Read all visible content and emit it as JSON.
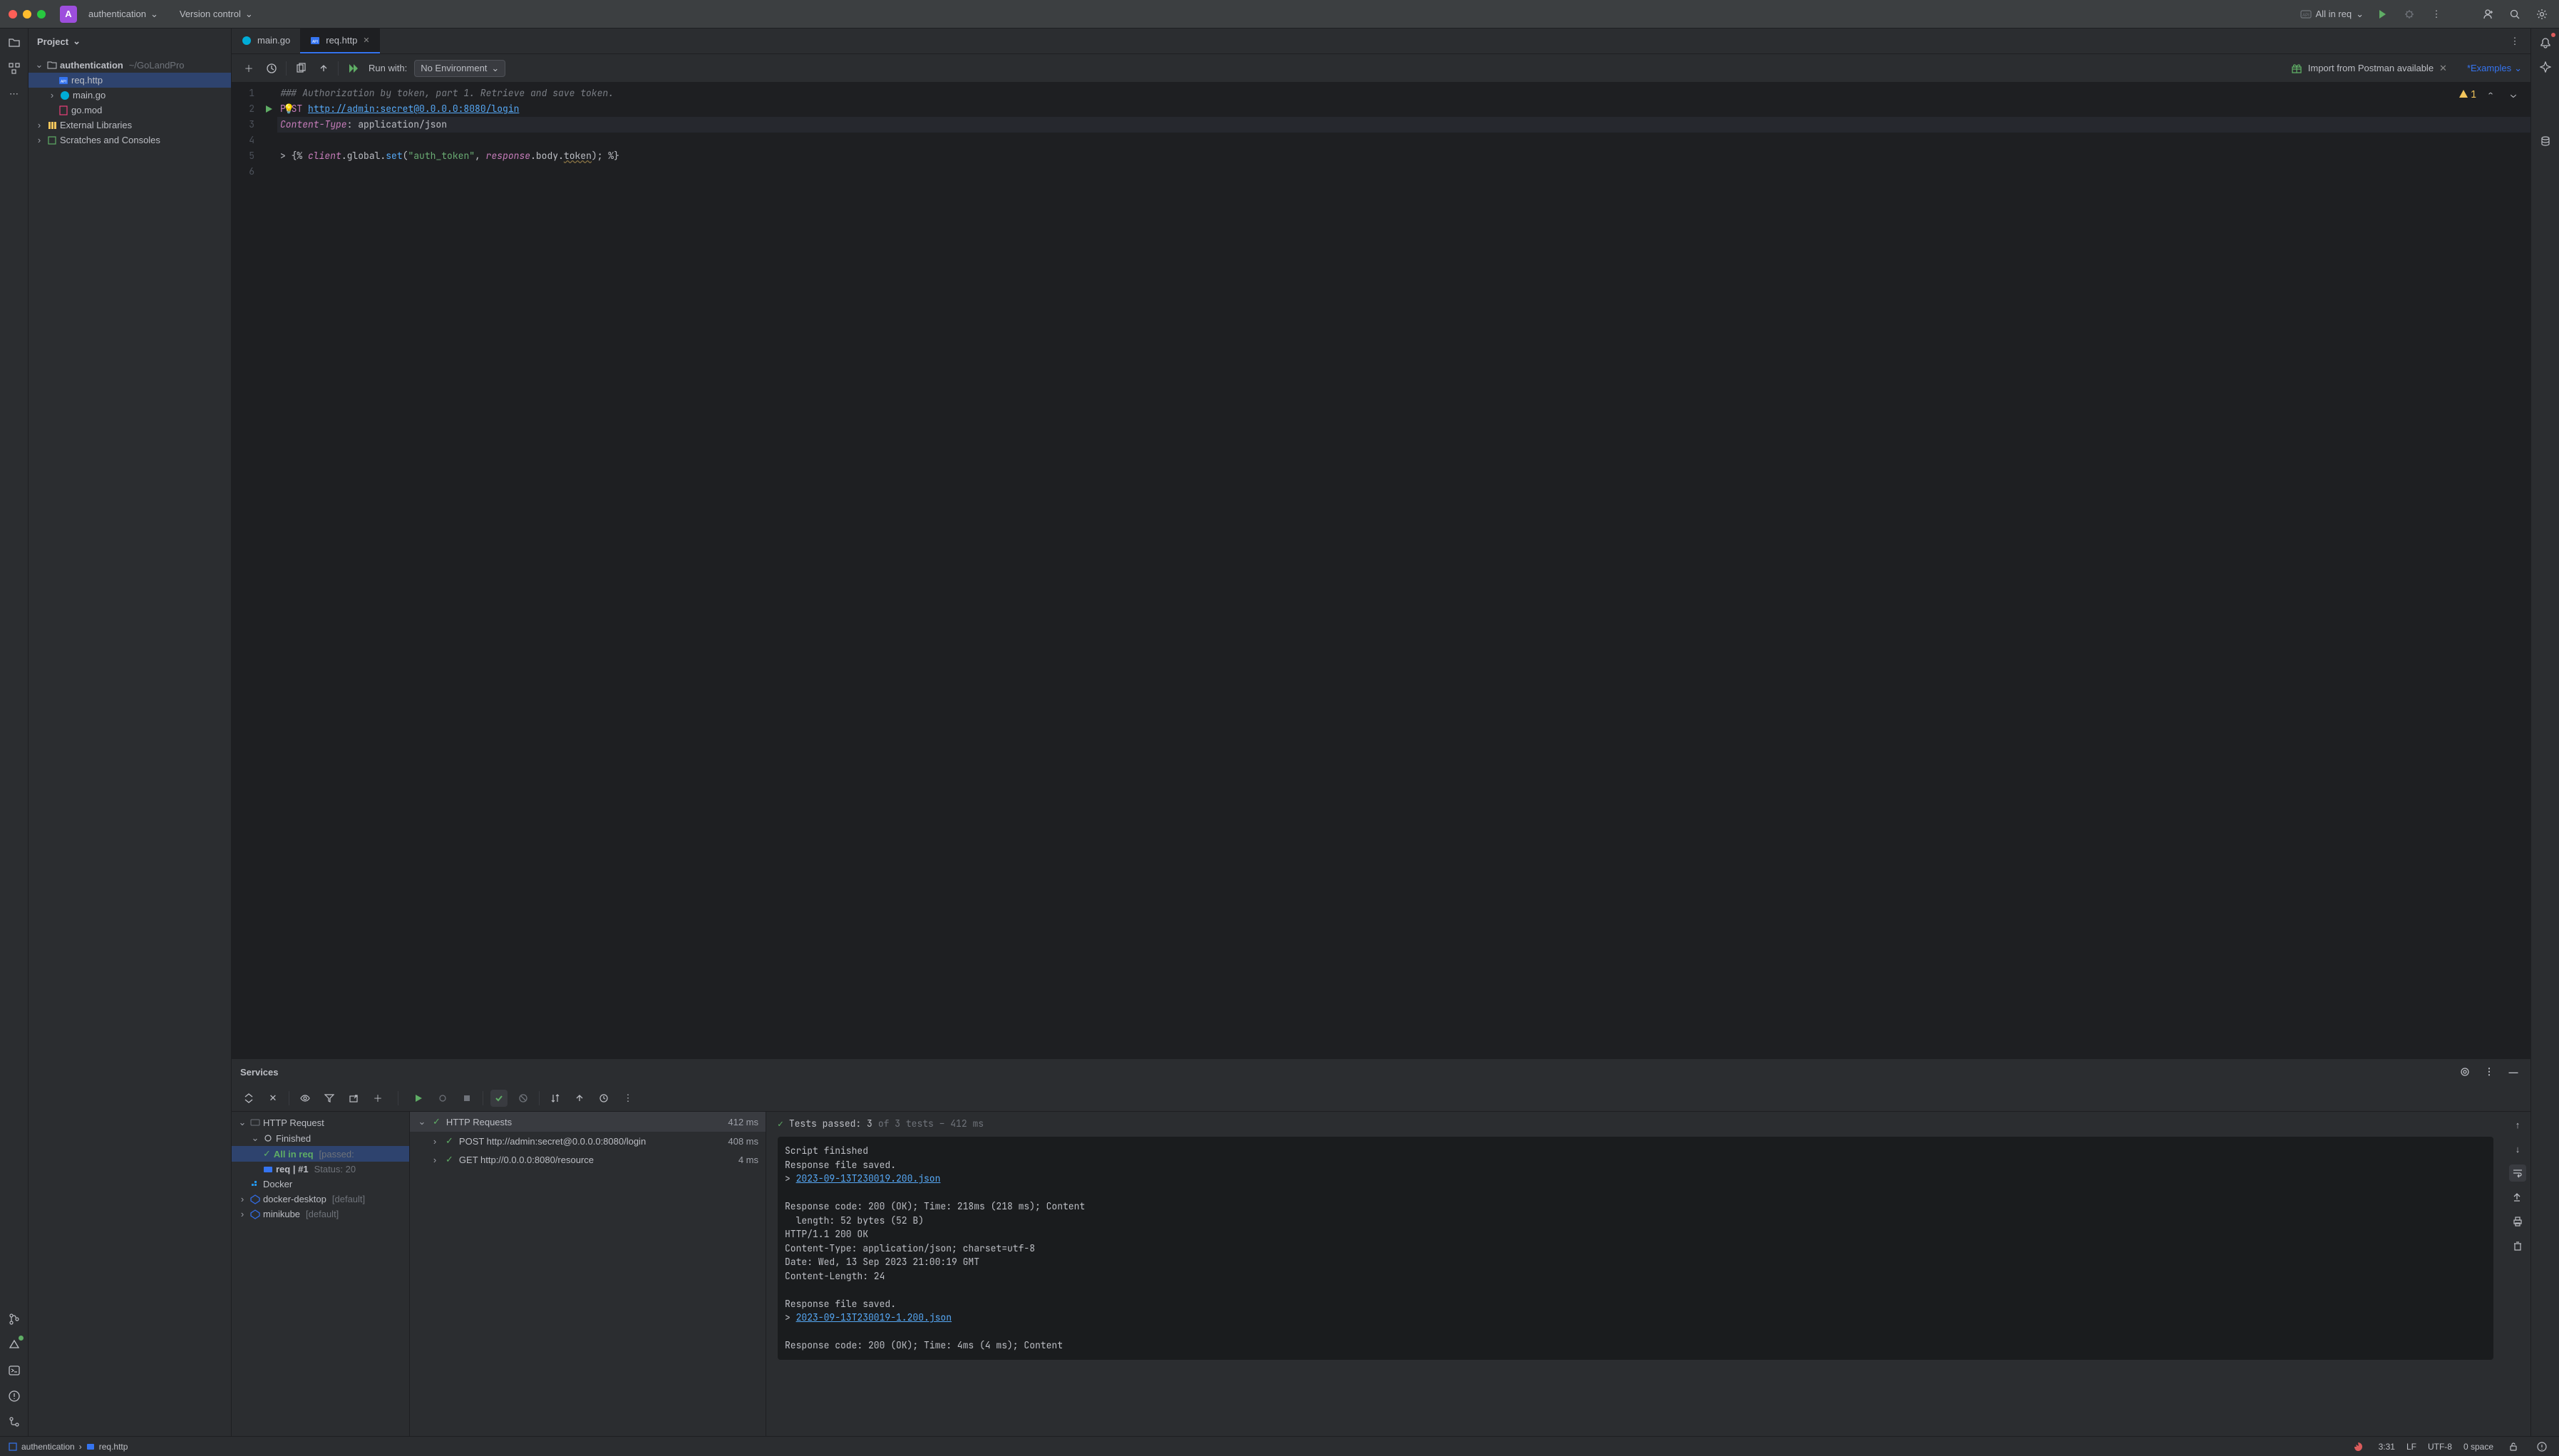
{
  "titlebar": {
    "project_name": "authentication",
    "version_control": "Version control",
    "run_config": "All in req"
  },
  "project_panel": {
    "title": "Project",
    "root": "authentication",
    "root_path": "~/GoLandPro",
    "files": [
      "req.http",
      "main.go",
      "go.mod"
    ],
    "ext_lib": "External Libraries",
    "scratches": "Scratches and Consoles"
  },
  "tabs": {
    "items": [
      {
        "label": "main.go",
        "icon": "go"
      },
      {
        "label": "req.http",
        "icon": "api"
      }
    ]
  },
  "toolbar": {
    "run_with": "Run with:",
    "env": "No Environment",
    "import_banner": "Import from Postman available",
    "examples": "*Examples"
  },
  "editor": {
    "lines": {
      "l1_comment": "### Authorization by token, part 1. Retrieve and save token.",
      "l2_method": "POST",
      "l2_url": "http://admin:secret@0.0.0.0:8080/login",
      "l3_header": "Content-Type",
      "l3_value": ": application/json",
      "l5_open": "> {% ",
      "l5_client": "client",
      "l5_global": ".global.",
      "l5_set": "set",
      "l5_arg1": "(\"auth_token\", ",
      "l5_response": "response",
      "l5_body": ".body.",
      "l5_token": "token",
      "l5_close": "); %}"
    },
    "warning_count": "1"
  },
  "services": {
    "title": "Services",
    "tree": {
      "http_request": "HTTP Request",
      "finished": "Finished",
      "all_in_req": "All in req",
      "all_in_req_suffix": "[passed:",
      "req_run": "req | #1",
      "req_run_status": "Status: 20",
      "docker": "Docker",
      "docker_desktop": "docker-desktop",
      "docker_desktop_suffix": "[default]",
      "minikube": "minikube",
      "minikube_suffix": "[default]"
    },
    "requests": {
      "header": "HTTP Requests",
      "header_time": "412 ms",
      "items": [
        {
          "label": "POST http://admin:secret@0.0.0.0:8080/login",
          "time": "408 ms"
        },
        {
          "label": "GET http://0.0.0.0:8080/resource",
          "time": "4 ms"
        }
      ]
    },
    "output": {
      "tests": "Tests passed: 3",
      "tests_of": "of 3 tests – 412 ms",
      "line1": "Script finished",
      "line2": "Response file saved.",
      "link1": "2023-09-13T230019.200.json",
      "resp1a": "Response code: 200 (OK); Time: 218ms (218 ms); Content",
      "resp1b": "  length: 52 bytes (52 B)",
      "http1": "HTTP/1.1 200 OK",
      "http2": "Content-Type: application/json; charset=utf-8",
      "http3": "Date: Wed, 13 Sep 2023 21:00:19 GMT",
      "http4": "Content-Length: 24",
      "line3": "Response file saved.",
      "link2": "2023-09-13T230019-1.200.json",
      "resp2": "Response code: 200 (OK); Time: 4ms (4 ms); Content"
    }
  },
  "statusbar": {
    "crumb1": "authentication",
    "crumb2": "req.http",
    "cursor": "3:31",
    "eol": "LF",
    "encoding": "UTF-8",
    "indent": "0 space"
  }
}
